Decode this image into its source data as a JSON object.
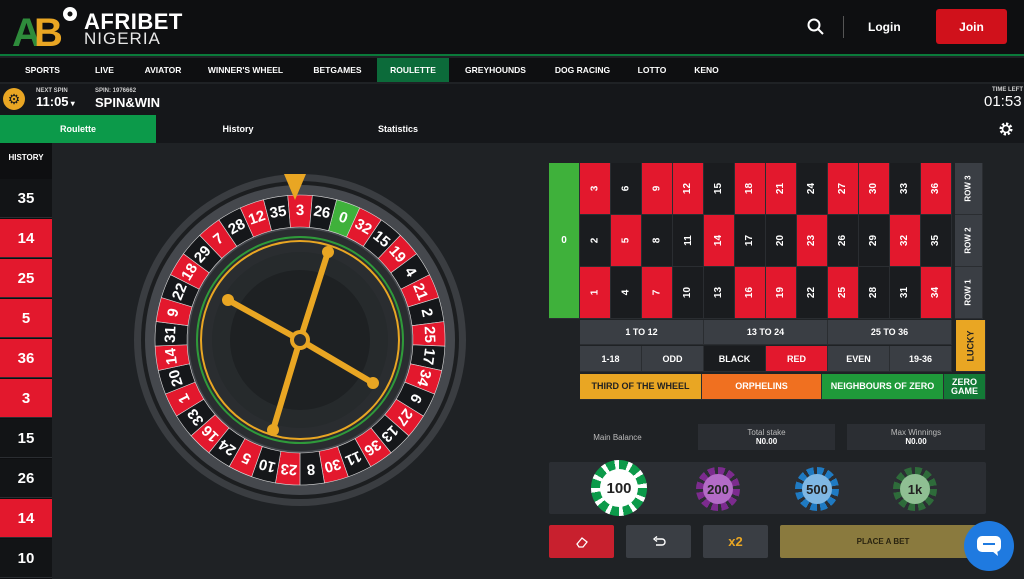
{
  "header": {
    "brand": "AFRIBET",
    "brand_sub": "NIGERIA",
    "login": "Login",
    "join": "Join"
  },
  "nav": [
    "SPORTS",
    "LIVE",
    "AVIATOR",
    "WINNER'S WHEEL",
    "BETGAMES",
    "ROULETTE",
    "GREYHOUNDS",
    "DOG RACING",
    "LOTTO",
    "KENO"
  ],
  "spin": {
    "next_label": "NEXT SPIN",
    "next_time": "11:05",
    "spin_label": "SPIN: 1976662",
    "game": "SPIN&WIN",
    "time_left_label": "TIME LEFT",
    "time_left": "01:53"
  },
  "tabs": [
    "Roulette",
    "History",
    "Statistics"
  ],
  "history": {
    "label": "HISTORY",
    "items": [
      {
        "n": "35",
        "c": "black"
      },
      {
        "n": "14",
        "c": "red"
      },
      {
        "n": "25",
        "c": "red"
      },
      {
        "n": "5",
        "c": "red"
      },
      {
        "n": "36",
        "c": "red"
      },
      {
        "n": "3",
        "c": "red"
      },
      {
        "n": "15",
        "c": "black"
      },
      {
        "n": "26",
        "c": "black"
      },
      {
        "n": "14",
        "c": "red"
      },
      {
        "n": "10",
        "c": "black"
      }
    ]
  },
  "wheel_numbers": [
    "0",
    "32",
    "15",
    "19",
    "4",
    "21",
    "2",
    "25",
    "17",
    "34",
    "6",
    "27",
    "13",
    "36",
    "11",
    "30",
    "8",
    "23",
    "10",
    "5",
    "24",
    "16",
    "33",
    "1",
    "20",
    "14",
    "31",
    "9",
    "22",
    "18",
    "29",
    "7",
    "28",
    "12",
    "35",
    "3",
    "26"
  ],
  "red_numbers": [
    "1",
    "3",
    "5",
    "7",
    "9",
    "12",
    "14",
    "16",
    "18",
    "19",
    "21",
    "23",
    "25",
    "27",
    "30",
    "32",
    "34",
    "36"
  ],
  "bet_table": {
    "zero": "0",
    "rows": [
      [
        "3",
        "6",
        "9",
        "12",
        "15",
        "18",
        "21",
        "24",
        "27",
        "30",
        "33",
        "36"
      ],
      [
        "2",
        "5",
        "8",
        "11",
        "14",
        "17",
        "20",
        "23",
        "26",
        "29",
        "32",
        "35"
      ],
      [
        "1",
        "4",
        "7",
        "10",
        "13",
        "16",
        "19",
        "22",
        "25",
        "28",
        "31",
        "34"
      ]
    ],
    "row_labels": [
      "ROW 3",
      "ROW 2",
      "ROW 1"
    ],
    "dozens": [
      "1 TO 12",
      "13 TO 24",
      "25 TO 36"
    ],
    "outside": [
      "1-18",
      "ODD",
      "BLACK",
      "RED",
      "EVEN",
      "19-36"
    ],
    "lucky": "LUCKY",
    "sectors": [
      "THIRD OF THE WHEEL",
      "ORPHELINS",
      "NEIGHBOURS OF ZERO",
      "ZERO GAME"
    ]
  },
  "balance": {
    "main": "Main Balance",
    "stake_label": "Total stake",
    "stake": "N0.00",
    "max_label": "Max Winnings",
    "max": "N0.00"
  },
  "chips": [
    "100",
    "200",
    "500",
    "1k"
  ],
  "actions": {
    "double": "x2",
    "place": "PLACE A BET"
  },
  "colors": {
    "red": "#e3182d",
    "green": "#0c6b3a",
    "accent": "#e9a623",
    "black": "#1a1c1f"
  }
}
